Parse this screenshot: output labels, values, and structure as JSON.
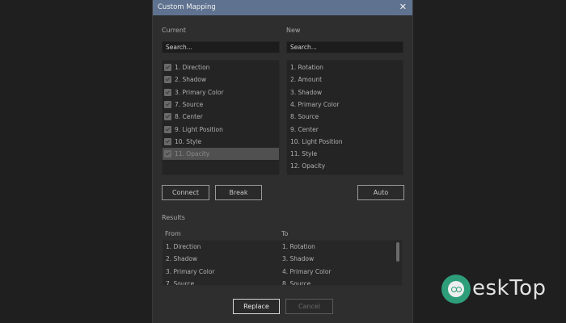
{
  "dialog": {
    "title": "Custom Mapping",
    "close_glyph": "✕"
  },
  "current": {
    "label": "Current",
    "search_placeholder": "Search...",
    "items": [
      {
        "label": "1. Direction",
        "checked": true
      },
      {
        "label": "2. Shadow",
        "checked": true
      },
      {
        "label": "3. Primary Color",
        "checked": true
      },
      {
        "label": "7. Source",
        "checked": true
      },
      {
        "label": "8. Center",
        "checked": true
      },
      {
        "label": "9. Light Position",
        "checked": true
      },
      {
        "label": "10. Style",
        "checked": true
      },
      {
        "label": "11. Opacity",
        "checked": true,
        "selected": true
      }
    ]
  },
  "new": {
    "label": "New",
    "search_placeholder": "Search...",
    "items": [
      "1. Rotation",
      "2. Amount",
      "3. Shadow",
      "4. Primary Color",
      "8. Source",
      "9. Center",
      "10. Light Position",
      "11. Style",
      "12. Opacity"
    ]
  },
  "buttons": {
    "connect": "Connect",
    "break": "Break",
    "auto": "Auto",
    "replace": "Replace",
    "cancel": "Cancel"
  },
  "results": {
    "label": "Results",
    "from_header": "From",
    "to_header": "To",
    "rows": [
      {
        "from": "1. Direction",
        "to": "1. Rotation"
      },
      {
        "from": "2. Shadow",
        "to": "3. Shadow"
      },
      {
        "from": "3. Primary Color",
        "to": "4. Primary Color"
      },
      {
        "from": "7. Source",
        "to": "8. Source"
      }
    ]
  },
  "watermark": {
    "text": "eskTop",
    "accent": "#2e9d7a"
  }
}
